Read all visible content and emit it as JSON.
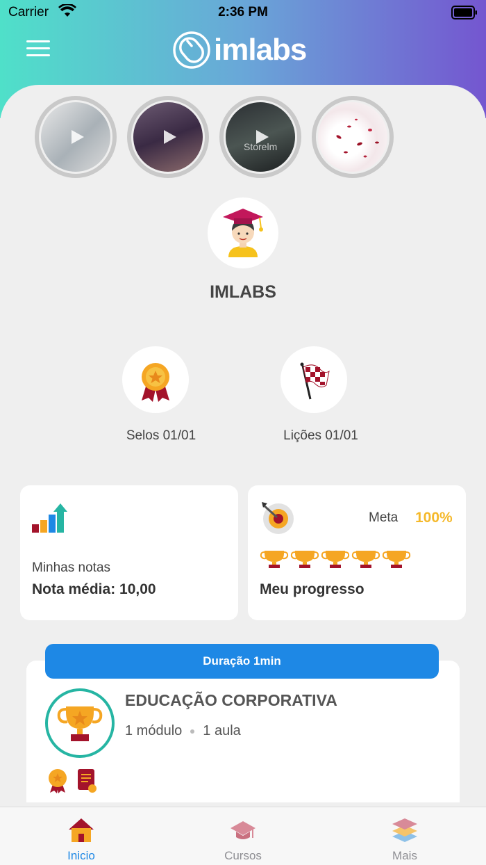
{
  "status_bar": {
    "carrier": "Carrier",
    "time": "2:36 PM"
  },
  "header": {
    "logo_text": "imlabs"
  },
  "stories": [
    {
      "label": ""
    },
    {
      "label": ""
    },
    {
      "label": "Storelm"
    },
    {
      "label": ""
    }
  ],
  "user": {
    "name": "IMLABS"
  },
  "stats": {
    "seals": "Selos 01/01",
    "lessons": "Lições 01/01"
  },
  "grades_card": {
    "subtitle": "Minhas notas",
    "average": "Nota média: 10,00"
  },
  "progress_card": {
    "goal_label": "Meta",
    "goal_value": "100%",
    "title": "Meu progresso",
    "trophies": 5
  },
  "course": {
    "duration": "Duração 1min",
    "title": "EDUCAÇÃO CORPORATIVA",
    "modules": "1 módulo",
    "lessons": "1 aula"
  },
  "tabbar": {
    "items": [
      {
        "label": "Inicio",
        "active": true
      },
      {
        "label": "Cursos",
        "active": false
      },
      {
        "label": "Mais",
        "active": false
      }
    ]
  },
  "colors": {
    "accent": "#1e88e5",
    "gold": "#f5b92b",
    "teal": "#26b5a3",
    "inactive_tab": "#8e8e93"
  }
}
